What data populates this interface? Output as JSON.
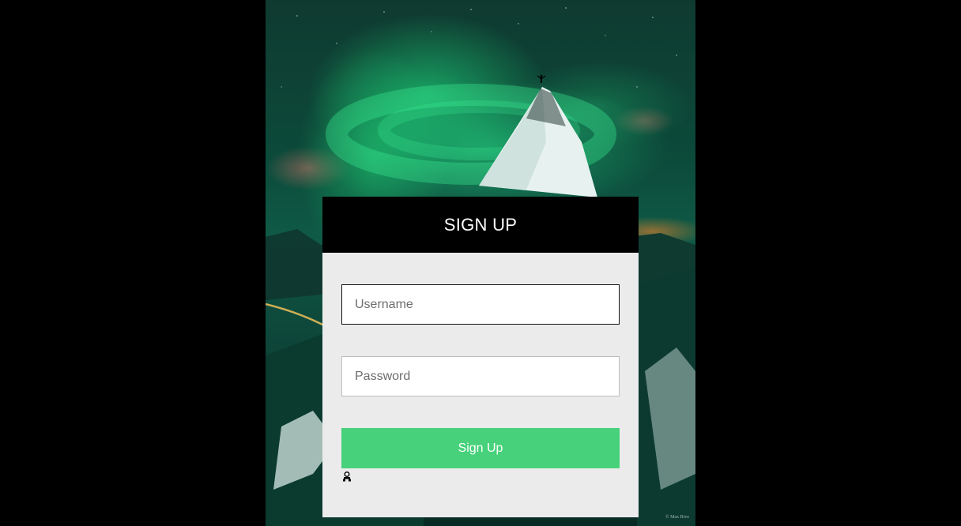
{
  "card": {
    "title": "SIGN UP",
    "username_placeholder": "Username",
    "password_placeholder": "Password",
    "submit_label": "Sign Up"
  },
  "photo": {
    "credit": "© Max Rive"
  },
  "colors": {
    "page_background": "#000000",
    "header_background": "#000000",
    "card_background": "#ebebeb",
    "button_green": "#46d17a"
  },
  "icons": {
    "small_icon_below_button": "person-icon"
  }
}
